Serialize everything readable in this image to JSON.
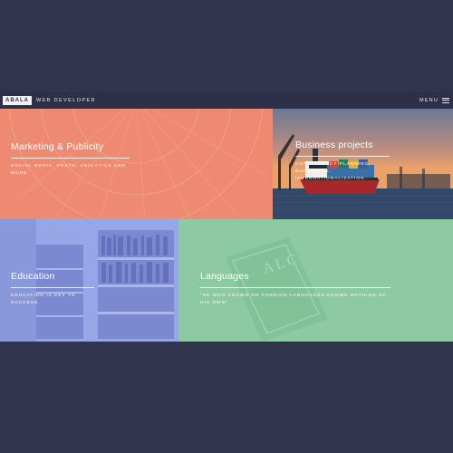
{
  "header": {
    "logo": "ABALA",
    "subtitle": "WEB DEVELOPER",
    "menu_label": "MENU"
  },
  "tiles": [
    {
      "title": "Marketing & Publicity",
      "subtitle": "SOCIAL MEDIA, POSTS, ANALYTICS AND MORE",
      "color": "#ed8a71"
    },
    {
      "title": "Business projects",
      "subtitle": "CONTINGENCY PLANNING, BUDGETING, INTERNATIONALIZATION...",
      "color": "#5b6a86"
    },
    {
      "title": "Education",
      "subtitle": "EDUCATION IS KEY TO SUCCESS",
      "color": "#96a7e7"
    },
    {
      "title": "Languages",
      "subtitle": "\"HE WHO KNOWS NO FOREIGN LANGUAGES KNOWS NOTHING OF HIS OWN\"",
      "color": "#8dcaa2"
    }
  ],
  "icons": {
    "menu": "hamburger-icon"
  }
}
